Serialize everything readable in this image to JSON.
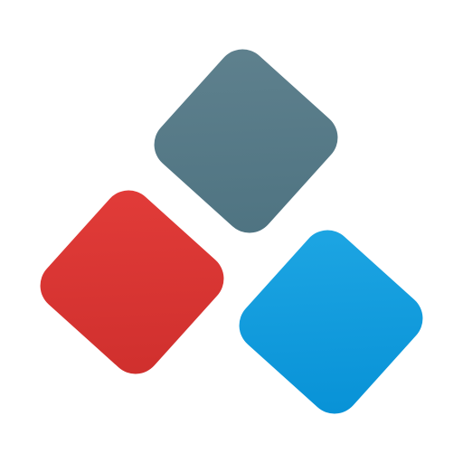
{
  "logo": {
    "name": "three-tile-logo",
    "tiles": [
      {
        "id": "tile-gray",
        "color_top": "#5b7d8a",
        "color_bottom": "#4e7381"
      },
      {
        "id": "tile-red",
        "color_top": "#e03a37",
        "color_bottom": "#d0302e"
      },
      {
        "id": "tile-blue",
        "color_top": "#1aa3e0",
        "color_bottom": "#0993d8"
      }
    ]
  }
}
